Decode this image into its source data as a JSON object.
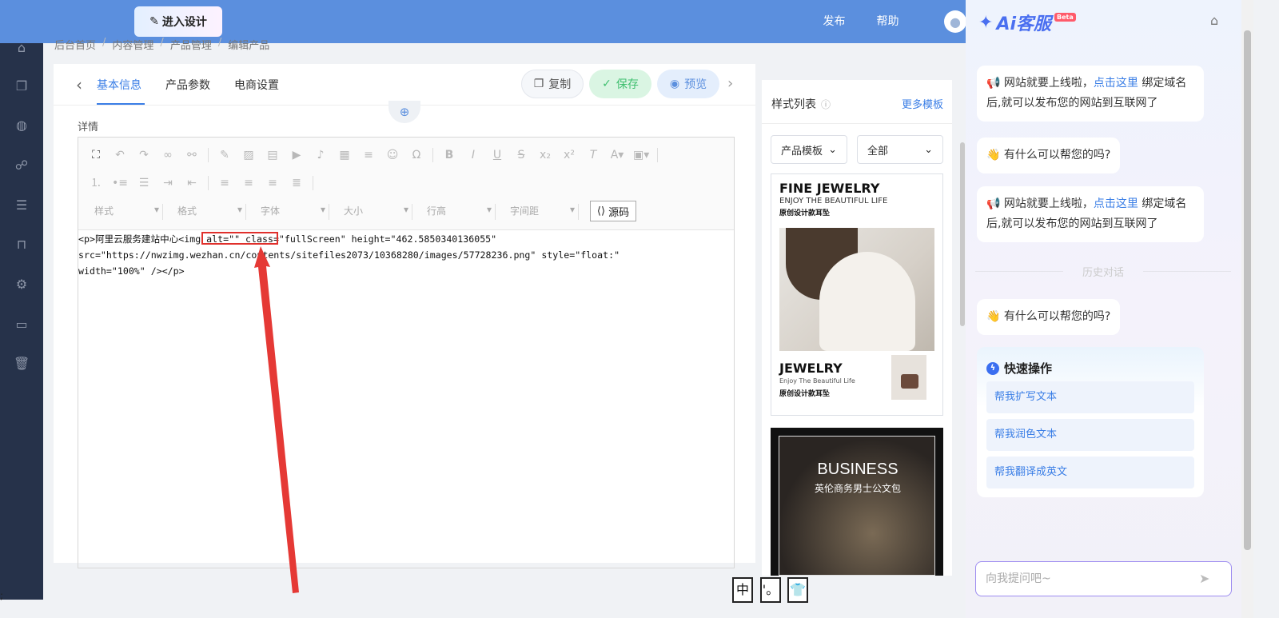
{
  "header": {
    "enter_design": "进入设计",
    "nav": [
      "发布",
      "帮助"
    ]
  },
  "sidebar": {
    "icons": [
      "home-icon",
      "pages-icon",
      "planet-icon",
      "chat-icon",
      "list-icon",
      "bag-icon",
      "gear-icon",
      "terminal-icon",
      "trash-icon"
    ]
  },
  "breadcrumb": [
    "后台首页",
    "内容管理",
    "产品管理",
    "编辑产品"
  ],
  "tabs": [
    "基本信息",
    "产品参数",
    "电商设置"
  ],
  "actions": {
    "copy": "复制",
    "save": "保存",
    "preview": "预览"
  },
  "detail_label": "详情",
  "editor": {
    "selects": [
      "样式",
      "格式",
      "字体",
      "大小",
      "行高",
      "字间距"
    ],
    "source_label": "源码",
    "code_lines": [
      "<p>阿里云服务建站中心<img alt=\"\" class=\"fullScreen\" height=\"462.5850340136055\"",
      "src=\"https://nwzimg.wezhan.cn/contents/sitefiles2073/10368280/images/57728236.png\" style=\"float:\"",
      "width=\"100%\" /></p>"
    ]
  },
  "style_panel": {
    "title": "样式列表",
    "more": "更多模板",
    "select_category": "产品模板",
    "select_filter": "全部",
    "template1": {
      "title": "FINE JEWELRY",
      "subtitle": "ENJOY THE BEAUTIFUL LIFE",
      "caption": "原创设计款耳坠",
      "title2": "JEWELRY",
      "subtitle2": "Enjoy The Beautiful Life",
      "caption2": "原创设计款耳坠"
    },
    "template2": {
      "title": "BUSINESS",
      "subtitle": "英伦商务男士公文包"
    }
  },
  "floating_boxes": [
    "中",
    "'。",
    "👕"
  ],
  "stray_char": ";",
  "ai": {
    "logo": "Ai客服",
    "beta": "Beta",
    "msg1_pre": "📢 网站就要上线啦，",
    "msg1_link": "点击这里",
    "msg1_post": "绑定域名后,就可以发布您的网站到互联网了",
    "msg2": "👋 有什么可以帮您的吗?",
    "history": "历史对话",
    "quick_title": "快速操作",
    "quick_items": [
      "帮我扩写文本",
      "帮我润色文本",
      "帮我翻译成英文"
    ],
    "input_placeholder": "向我提问吧~"
  }
}
